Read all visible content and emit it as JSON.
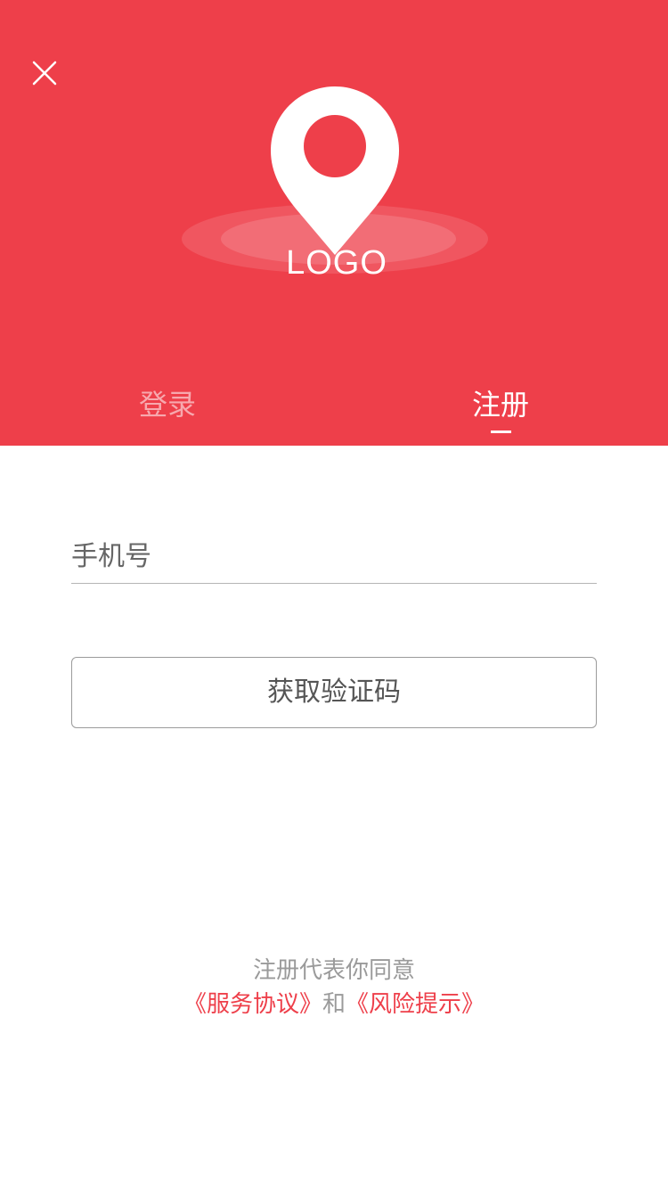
{
  "colors": {
    "brand": "#ee3f4a",
    "tab_inactive": "#f7a8ae",
    "link": "#ee3f4a"
  },
  "header": {
    "close_icon": "close-icon",
    "logo_icon": "map-pin-icon",
    "logo_text": "LOGO"
  },
  "tabs": [
    {
      "label": "登录",
      "active": false
    },
    {
      "label": "注册",
      "active": true
    }
  ],
  "form": {
    "phone_placeholder": "手机号",
    "phone_value": "",
    "get_code_label": "获取验证码"
  },
  "agreement": {
    "line1": "注册代表你同意",
    "service_link": "《服务协议》",
    "conjunction": "和",
    "risk_link": "《风险提示》"
  }
}
